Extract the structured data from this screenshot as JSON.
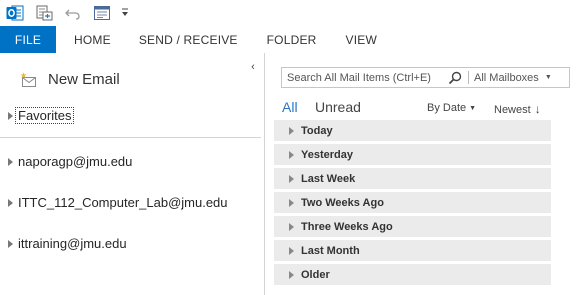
{
  "quick_access": {
    "icons": [
      "outlook-logo",
      "send-receive-all-folders",
      "undo",
      "customize-form",
      "customize-quick-access-toolbar"
    ]
  },
  "ribbon": {
    "tabs": [
      "FILE",
      "HOME",
      "SEND / RECEIVE",
      "FOLDER",
      "VIEW"
    ]
  },
  "folder_pane": {
    "collapse_glyph": "‹",
    "new_email_label": "New Email",
    "favorites_label": "Favorites",
    "accounts": [
      "naporagp@jmu.edu",
      "ITTC_112_Computer_Lab@jmu.edu",
      "ittraining@jmu.edu"
    ]
  },
  "message_list": {
    "search_placeholder": "Search All Mail Items (Ctrl+E)",
    "search_scope": "All Mailboxes",
    "filter_all": "All",
    "filter_unread": "Unread",
    "sort_by": "By Date",
    "sort_order": "Newest",
    "sort_arrow": "↓",
    "groups": [
      "Today",
      "Yesterday",
      "Last Week",
      "Two Weeks Ago",
      "Three Weeks Ago",
      "Last Month",
      "Older"
    ]
  },
  "colors": {
    "file_tab_bg": "#0072c6",
    "accent_blue": "#2a75c2",
    "group_header_bg": "#ebebeb"
  }
}
